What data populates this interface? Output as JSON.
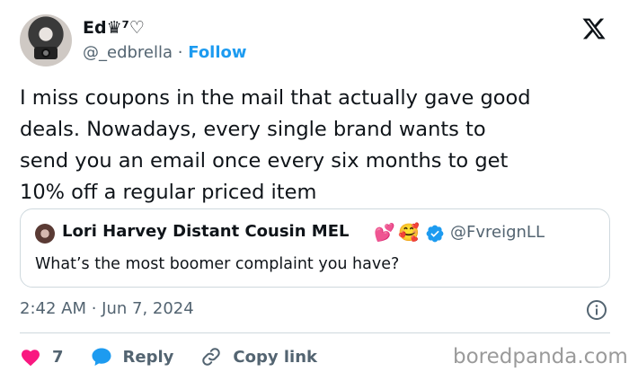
{
  "author": {
    "name": "Ed♛⁷♡",
    "handle": "@_edbrella",
    "separator": "·",
    "follow_label": "Follow"
  },
  "tweet": {
    "lines": [
      "I miss coupons in the mail that actually gave good",
      "deals. Nowadays, every single brand wants to",
      "send you an email once every six months to get",
      "10% off a regular priced item"
    ]
  },
  "quoted": {
    "name": "Lori Harvey Distant Cousin MEL",
    "emoji_1": "💕",
    "emoji_2": "🥰",
    "handle": "@FvreignLL",
    "text": "What’s the most boomer complaint you have?"
  },
  "meta": {
    "timestamp": "2:42 AM · Jun 7, 2024"
  },
  "actions": {
    "like_count": "7",
    "reply_label": "Reply",
    "copy_label": "Copy link"
  },
  "watermark": "boredpanda.com",
  "colors": {
    "accent": "#1d9bf0",
    "like": "#f91880",
    "text": "#0f1419",
    "secondary": "#536471",
    "border": "#cfd9de"
  },
  "icons": [
    "x-logo-icon",
    "verified-badge-icon",
    "info-icon",
    "heart-icon",
    "reply-bubble-icon",
    "link-icon"
  ]
}
